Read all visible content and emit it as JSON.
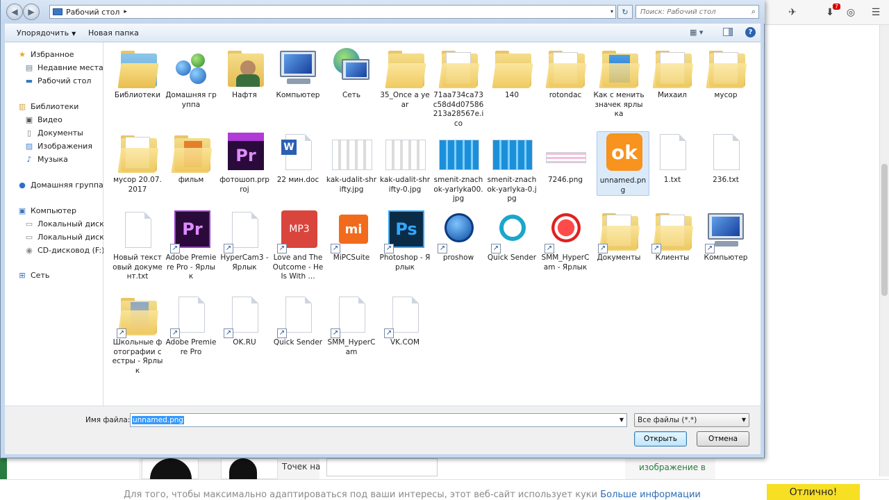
{
  "dialog": {
    "address": "Рабочий стол",
    "search_placeholder": "Поиск: Рабочий стол",
    "organize": "Упорядочить",
    "new_folder": "Новая папка",
    "file_name_label": "Имя файла:",
    "file_name_value": "unnamed.png",
    "file_type": "Все файлы (*.*)",
    "open_label": "Открыть",
    "cancel_label": "Отмена"
  },
  "nav": [
    {
      "label": "Избранное",
      "icon": "star-icon"
    },
    {
      "label": "Недавние места",
      "icon": "recent-places-icon"
    },
    {
      "label": "Рабочий стол",
      "icon": "desktop-icon"
    },
    {
      "label": "Библиотеки",
      "icon": "libraries-icon"
    },
    {
      "label": "Видео",
      "icon": "video-library-icon"
    },
    {
      "label": "Документы",
      "icon": "documents-library-icon"
    },
    {
      "label": "Изображения",
      "icon": "pictures-library-icon"
    },
    {
      "label": "Музыка",
      "icon": "music-library-icon"
    },
    {
      "label": "Домашняя группа",
      "icon": "homegroup-icon"
    },
    {
      "label": "Компьютер",
      "icon": "computer-icon"
    },
    {
      "label": "Локальный диск (C",
      "icon": "local-disk-icon"
    },
    {
      "label": "Локальный диск (D",
      "icon": "local-disk-icon"
    },
    {
      "label": "CD-дисковод (F:)",
      "icon": "cd-drive-icon"
    },
    {
      "label": "Сеть",
      "icon": "network-icon"
    }
  ],
  "files": [
    {
      "label": "Библиотеки",
      "icon": "libraries-folder-icon"
    },
    {
      "label": "Домашняя группа",
      "icon": "homegroup-icon"
    },
    {
      "label": "Нафтя",
      "icon": "user-folder-icon"
    },
    {
      "label": "Компьютер",
      "icon": "computer-icon"
    },
    {
      "label": "Сеть",
      "icon": "network-globe-icon"
    },
    {
      "label": "35_Once a year",
      "icon": "folder-icon"
    },
    {
      "label": "71aa734ca73c58d4d07586213a28567e.ico",
      "icon": "folder-icon"
    },
    {
      "label": "140",
      "icon": "folder-icon"
    },
    {
      "label": "rotondac",
      "icon": "folder-icon"
    },
    {
      "label": "Как с менить значек ярлыка",
      "icon": "folder-icon"
    },
    {
      "label": "Михаил",
      "icon": "folder-icon"
    },
    {
      "label": "мусор",
      "icon": "folder-icon"
    },
    {
      "label": "мусор 20.07.2017",
      "icon": "folder-icon"
    },
    {
      "label": "фильм",
      "icon": "folder-icon"
    },
    {
      "label": "фотошоп.prproj",
      "icon": "premiere-project-icon"
    },
    {
      "label": "22 мин.doc",
      "icon": "word-doc-icon"
    },
    {
      "label": "kak-udalit-shrifty.jpg",
      "icon": "image-thumbnail-icon"
    },
    {
      "label": "kak-udalit-shrifty-0.jpg",
      "icon": "image-thumbnail-icon"
    },
    {
      "label": "smenit-znachok-yarlyka00.jpg",
      "icon": "image-thumbnail-icon"
    },
    {
      "label": "smenit-znachok-yarlyka-0.jpg",
      "icon": "image-thumbnail-icon"
    },
    {
      "label": "7246.png",
      "icon": "image-thumbnail-icon"
    },
    {
      "label": "unnamed.png",
      "icon": "odnoklassniki-image-icon"
    },
    {
      "label": "1.txt",
      "icon": "text-file-icon"
    },
    {
      "label": "236.txt",
      "icon": "text-file-icon"
    },
    {
      "label": "Новый текстовый документ.txt",
      "icon": "text-file-icon"
    },
    {
      "label": "Adobe Premiere Pro - Ярлык",
      "icon": "premiere-icon"
    },
    {
      "label": "HyperCam3 - Ярлык",
      "icon": "text-file-icon"
    },
    {
      "label": "Love and The Outcome - He Is With ...",
      "icon": "mp3-icon"
    },
    {
      "label": "MiPCSuite",
      "icon": "mi-icon"
    },
    {
      "label": "Photoshop - Ярлык",
      "icon": "photoshop-icon"
    },
    {
      "label": "proshow",
      "icon": "proshow-icon"
    },
    {
      "label": "Quick Sender",
      "icon": "quick-sender-icon"
    },
    {
      "label": "SMM_HyperCam - Ярлык",
      "icon": "record-icon"
    },
    {
      "label": "Документы",
      "icon": "folder-icon"
    },
    {
      "label": "Клиенты",
      "icon": "folder-icon"
    },
    {
      "label": "Компьютер",
      "icon": "computer-icon"
    },
    {
      "label": "Школьные фотографии сестры - Ярлык",
      "icon": "photo-folder-icon"
    },
    {
      "label": "Adobe Premiere Pro",
      "icon": "text-file-icon"
    },
    {
      "label": "OK.RU",
      "icon": "text-file-icon"
    },
    {
      "label": "Quick Sender",
      "icon": "text-file-icon"
    },
    {
      "label": "SMM_HyperCam",
      "icon": "text-file-icon"
    },
    {
      "label": "VK.COM",
      "icon": "text-file-icon"
    }
  ],
  "background": {
    "points_label": "Точек на",
    "green_text": "изображение в",
    "cookie_text": "Для того, чтобы максимально адаптироваться под ваши интересы, этот веб-сайт использует куки",
    "cookie_link": "Больше информации",
    "cookie_button": "Отлично!"
  },
  "colors": {
    "accent_green": "#2a7c3f",
    "cookie_button": "#f7df23",
    "selection": "#3399ff"
  }
}
